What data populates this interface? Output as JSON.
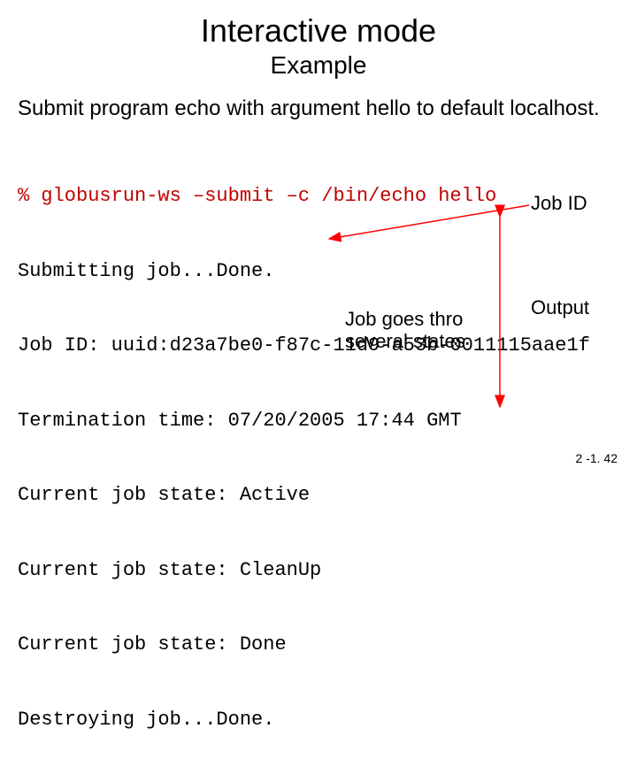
{
  "title": "Interactive mode",
  "subtitle": "Example",
  "description": "Submit program echo with argument hello to default localhost.",
  "terminal": {
    "command": "% globusrun-ws –submit –c /bin/echo hello",
    "lines": [
      "Submitting job...Done.",
      "Job ID: uuid:d23a7be0-f87c-11d9-a53b-0011115aae1f",
      "Termination time: 07/20/2005 17:44 GMT",
      "Current job state: Active",
      "Current job state: CleanUp",
      "Current job state: Done",
      "Destroying job...Done."
    ]
  },
  "annotations": {
    "job_id": "Job ID",
    "output": "Output",
    "job_states_l1": "Job goes thro",
    "job_states_l2": "several states"
  },
  "footer": "2 -1. 42",
  "colors": {
    "command": "#c00000",
    "arrow": "#ff0000"
  }
}
